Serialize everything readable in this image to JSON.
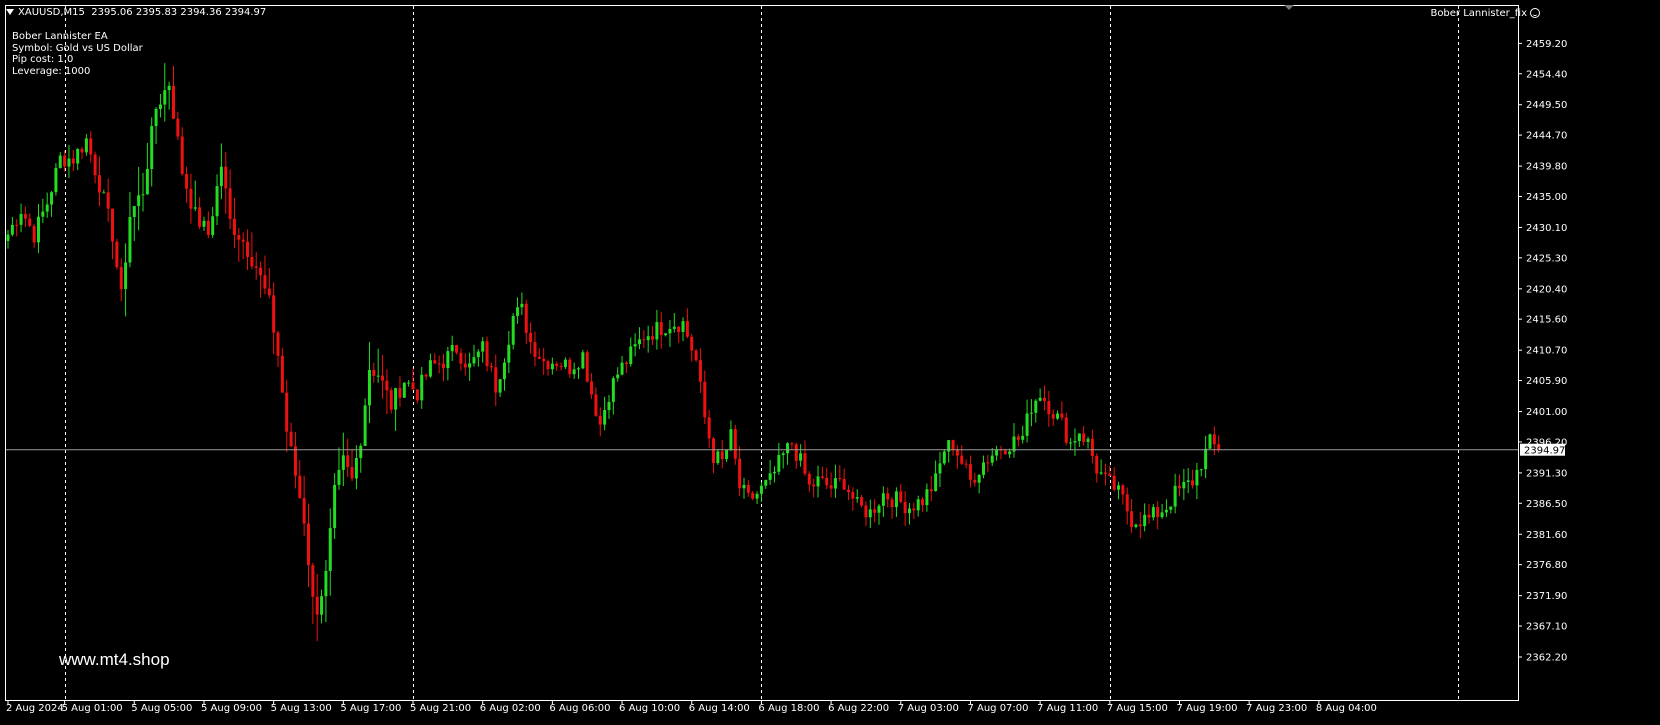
{
  "header": {
    "symbol": "XAUUSD,M15",
    "ohlc": "2395.06 2395.83 2394.36 2394.97"
  },
  "ea_info": {
    "lines": [
      "Bober Lannister EA",
      "Symbol: Gold vs US Dollar",
      "Pip cost: 1.0",
      "Leverage: 1000"
    ]
  },
  "ea_name": "Bober Lannister_fix",
  "watermark": "www.mt4.shop",
  "colors": {
    "background": "#000000",
    "bull": "#22dd22",
    "bear": "#ee1111",
    "grid": "#ffffff",
    "axis_text": "#ffffff",
    "price_line": "#9a9a9a"
  },
  "chart_data": {
    "type": "candlestick",
    "symbol": "XAUUSD",
    "timeframe": "M15",
    "current_price": 2394.97,
    "ylim": [
      2362.2,
      2461.0
    ],
    "ytick_labels": [
      "2459.20",
      "2454.40",
      "2449.50",
      "2444.70",
      "2439.80",
      "2435.00",
      "2430.10",
      "2425.30",
      "2420.40",
      "2415.60",
      "2410.70",
      "2405.90",
      "2401.00",
      "2396.20",
      "2391.30",
      "2386.50",
      "2381.60",
      "2376.80",
      "2371.90",
      "2367.10",
      "2362.20"
    ],
    "xtick_labels": [
      "2 Aug 2024",
      "5 Aug 01:00",
      "5 Aug 05:00",
      "5 Aug 09:00",
      "5 Aug 13:00",
      "5 Aug 17:00",
      "5 Aug 21:00",
      "6 Aug 02:00",
      "6 Aug 06:00",
      "6 Aug 10:00",
      "6 Aug 14:00",
      "6 Aug 18:00",
      "6 Aug 22:00",
      "7 Aug 03:00",
      "7 Aug 07:00",
      "7 Aug 11:00",
      "7 Aug 15:00",
      "7 Aug 19:00",
      "7 Aug 23:00",
      "8 Aug 04:00"
    ],
    "period_separators": [
      "5 Aug",
      "6 Aug",
      "7 Aug",
      "8 Aug",
      "9 Aug"
    ],
    "price_path": [
      [
        0,
        2429
      ],
      [
        3,
        2433
      ],
      [
        6,
        2429
      ],
      [
        9,
        2434
      ],
      [
        12,
        2441
      ],
      [
        15,
        2441
      ],
      [
        18,
        2444
      ],
      [
        21,
        2437
      ],
      [
        24,
        2429
      ],
      [
        26,
        2419
      ],
      [
        28,
        2432
      ],
      [
        31,
        2436
      ],
      [
        34,
        2449
      ],
      [
        37,
        2453
      ],
      [
        40,
        2439
      ],
      [
        43,
        2432
      ],
      [
        46,
        2429
      ],
      [
        49,
        2440
      ],
      [
        51,
        2431
      ],
      [
        54,
        2428
      ],
      [
        57,
        2424
      ],
      [
        60,
        2418
      ],
      [
        62,
        2410
      ],
      [
        64,
        2398
      ],
      [
        66,
        2391
      ],
      [
        68,
        2384
      ],
      [
        70,
        2371
      ],
      [
        71,
        2370
      ],
      [
        73,
        2375
      ],
      [
        75,
        2388
      ],
      [
        77,
        2393
      ],
      [
        79,
        2390
      ],
      [
        81,
        2397
      ],
      [
        83,
        2408
      ],
      [
        85,
        2407
      ],
      [
        88,
        2402
      ],
      [
        91,
        2406
      ],
      [
        94,
        2404
      ],
      [
        97,
        2408
      ],
      [
        100,
        2409
      ],
      [
        103,
        2411
      ],
      [
        106,
        2408
      ],
      [
        109,
        2411
      ],
      [
        112,
        2405
      ],
      [
        114,
        2410
      ],
      [
        116,
        2416
      ],
      [
        118,
        2417
      ],
      [
        120,
        2412
      ],
      [
        123,
        2409
      ],
      [
        126,
        2409
      ],
      [
        129,
        2408
      ],
      [
        132,
        2410
      ],
      [
        134,
        2404
      ],
      [
        136,
        2399
      ],
      [
        138,
        2404
      ],
      [
        140,
        2407
      ],
      [
        143,
        2410
      ],
      [
        146,
        2413
      ],
      [
        149,
        2414
      ],
      [
        152,
        2415
      ],
      [
        155,
        2415
      ],
      [
        158,
        2409
      ],
      [
        160,
        2400
      ],
      [
        162,
        2394
      ],
      [
        164,
        2393
      ],
      [
        166,
        2397
      ],
      [
        168,
        2389
      ],
      [
        170,
        2387
      ],
      [
        172,
        2388
      ],
      [
        175,
        2390
      ],
      [
        178,
        2394
      ],
      [
        180,
        2396
      ],
      [
        182,
        2393
      ],
      [
        184,
        2389
      ],
      [
        186,
        2390
      ],
      [
        189,
        2389
      ],
      [
        192,
        2390
      ],
      [
        195,
        2386
      ],
      [
        198,
        2385
      ],
      [
        201,
        2388
      ],
      [
        204,
        2387
      ],
      [
        207,
        2386
      ],
      [
        210,
        2387
      ],
      [
        213,
        2390
      ],
      [
        215,
        2395
      ],
      [
        217,
        2396
      ],
      [
        219,
        2393
      ],
      [
        221,
        2390
      ],
      [
        224,
        2393
      ],
      [
        227,
        2395
      ],
      [
        230,
        2396
      ],
      [
        233,
        2397
      ],
      [
        235,
        2402
      ],
      [
        237,
        2404
      ],
      [
        239,
        2402
      ],
      [
        242,
        2399
      ],
      [
        244,
        2396
      ],
      [
        246,
        2398
      ],
      [
        248,
        2396
      ],
      [
        250,
        2392
      ],
      [
        252,
        2390
      ],
      [
        254,
        2389
      ],
      [
        256,
        2387
      ],
      [
        258,
        2384
      ],
      [
        260,
        2384
      ],
      [
        262,
        2384
      ],
      [
        264,
        2385
      ],
      [
        266,
        2386
      ],
      [
        268,
        2388
      ],
      [
        270,
        2389
      ],
      [
        272,
        2390
      ],
      [
        274,
        2393
      ],
      [
        276,
        2396
      ],
      [
        278,
        2395
      ]
    ]
  }
}
